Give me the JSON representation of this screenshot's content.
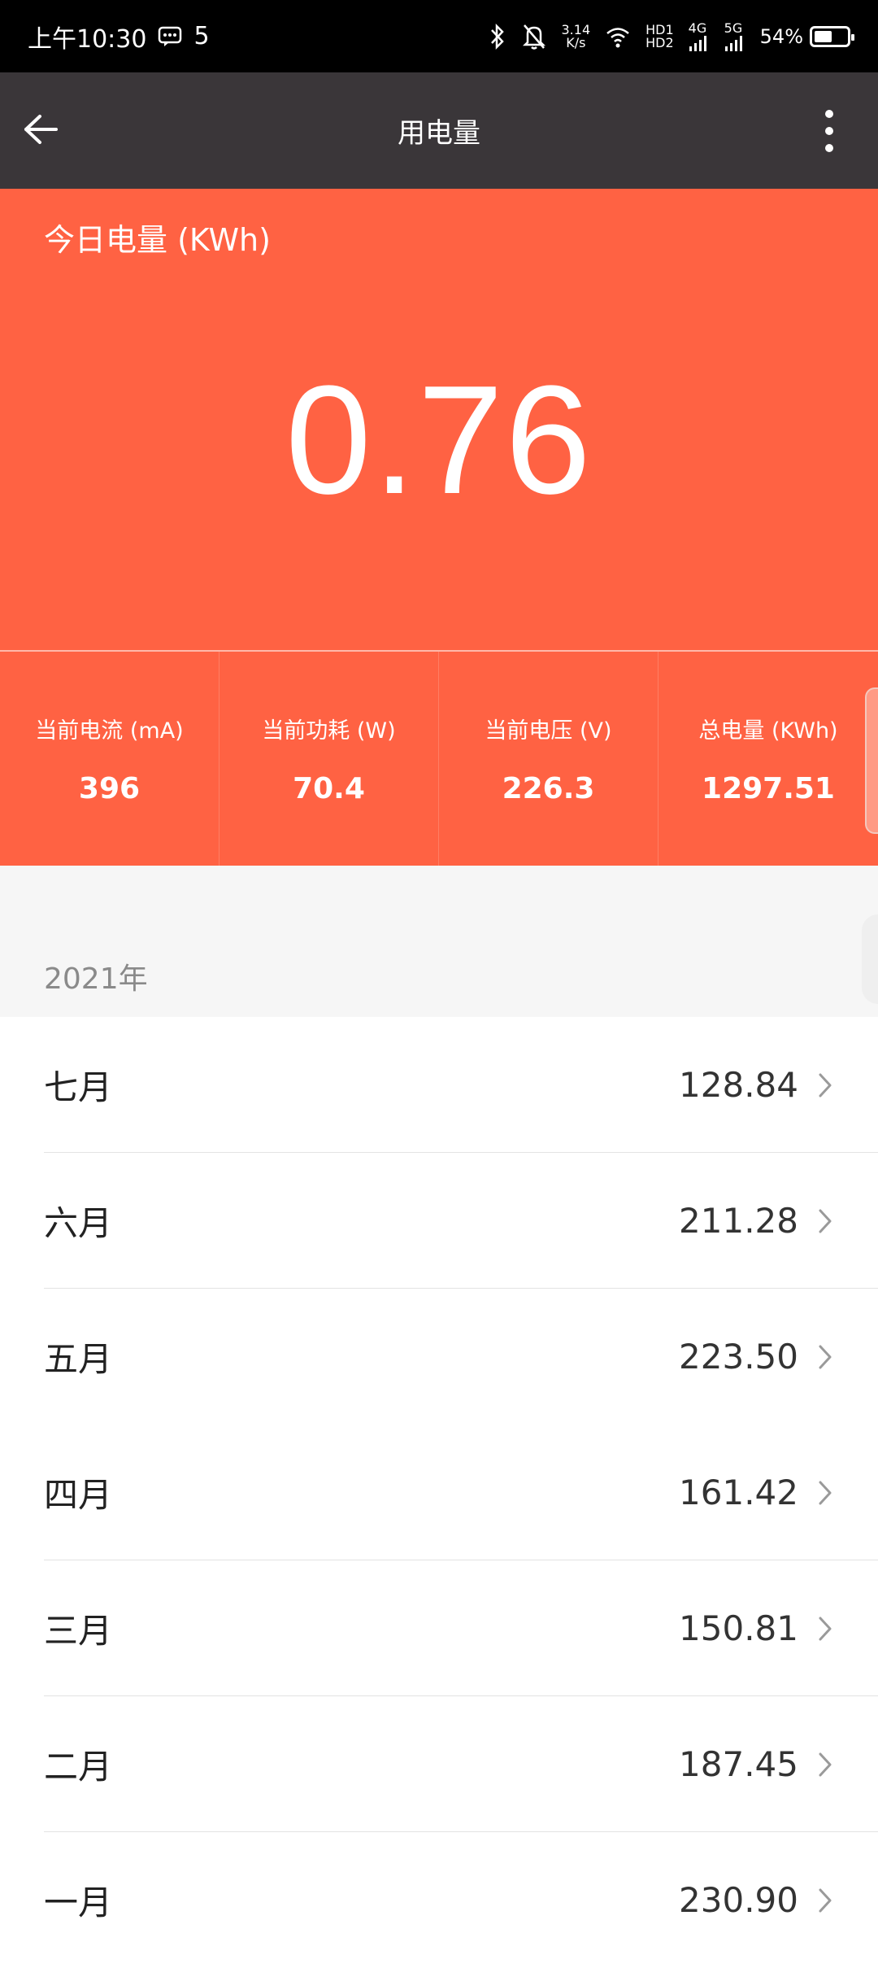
{
  "status_bar": {
    "time": "上午10:30",
    "msg_count": "5",
    "net_speed_value": "3.14",
    "net_speed_unit": "K/s",
    "hd1": "HD1",
    "hd2": "HD2",
    "net_4g": "4G",
    "net_5g": "5G",
    "battery": "54%",
    "battery_level": 0.54
  },
  "app_bar": {
    "title": "用电量"
  },
  "hero": {
    "label": "今日电量 (KWh)",
    "value": "0.76"
  },
  "stats": [
    {
      "label": "当前电流 (mA)",
      "value": "396"
    },
    {
      "label": "当前功耗 (W)",
      "value": "70.4"
    },
    {
      "label": "当前电压 (V)",
      "value": "226.3"
    },
    {
      "label": "总电量 (KWh)",
      "value": "1297.51"
    }
  ],
  "year": {
    "label": "2021年"
  },
  "months": [
    {
      "name": "七月",
      "value": "128.84"
    },
    {
      "name": "六月",
      "value": "211.28"
    },
    {
      "name": "五月",
      "value": "223.50"
    },
    {
      "name": "四月",
      "value": "161.42"
    },
    {
      "name": "三月",
      "value": "150.81"
    },
    {
      "name": "二月",
      "value": "187.45"
    },
    {
      "name": "一月",
      "value": "230.90"
    }
  ],
  "colors": {
    "accent": "#ff6243",
    "app_bar": "#3a3639",
    "status_bar": "#000000"
  }
}
